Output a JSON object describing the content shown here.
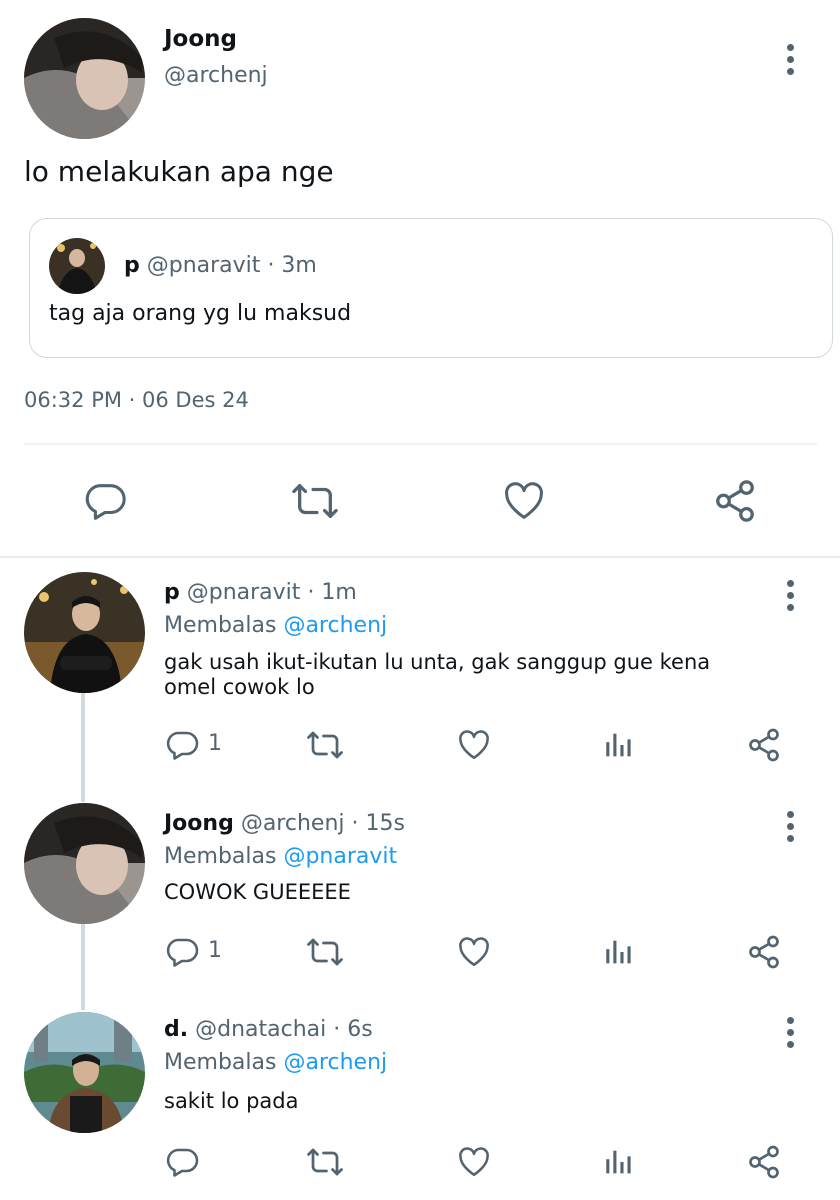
{
  "main_tweet": {
    "author_name": "Joong",
    "author_handle": "@archenj",
    "text": "lo melakukan apa nge",
    "quoted": {
      "author_name": "p",
      "author_handle": "@pnaravit",
      "time": "· 3m",
      "text": "tag aja orang yg lu maksud"
    },
    "timestamp": "06:32 PM · 06 Des 24"
  },
  "replies": [
    {
      "author_name": "p",
      "author_handle": "@pnaravit",
      "time": "· 1m",
      "replying_prefix": "Membalas",
      "replying_to": "@archenj",
      "text_line1": "gak usah ikut-ikutan lu unta, gak sanggup gue kena",
      "text_line2": "omel cowok lo",
      "reply_count": "1"
    },
    {
      "author_name": "Joong",
      "author_handle": "@archenj",
      "time": "· 15s",
      "replying_prefix": "Membalas",
      "replying_to": "@pnaravit",
      "text_line1": "COWOK GUEEEEE",
      "text_line2": "",
      "reply_count": "1"
    },
    {
      "author_name": "d.",
      "author_handle": "@dnatachai",
      "time": "· 6s",
      "replying_prefix": "Membalas",
      "replying_to": "@archenj",
      "text_line1": "sakit lo pada",
      "text_line2": "",
      "reply_count": ""
    }
  ],
  "colors": {
    "text": "#0f1419",
    "secondary": "#536471",
    "link": "#1d9bf0",
    "divider": "#eff3f4",
    "icon": "#536471"
  },
  "icons": [
    "avatar",
    "more-dots-icon",
    "reply-icon",
    "retweet-icon",
    "like-icon",
    "views-icon",
    "share-icon"
  ]
}
